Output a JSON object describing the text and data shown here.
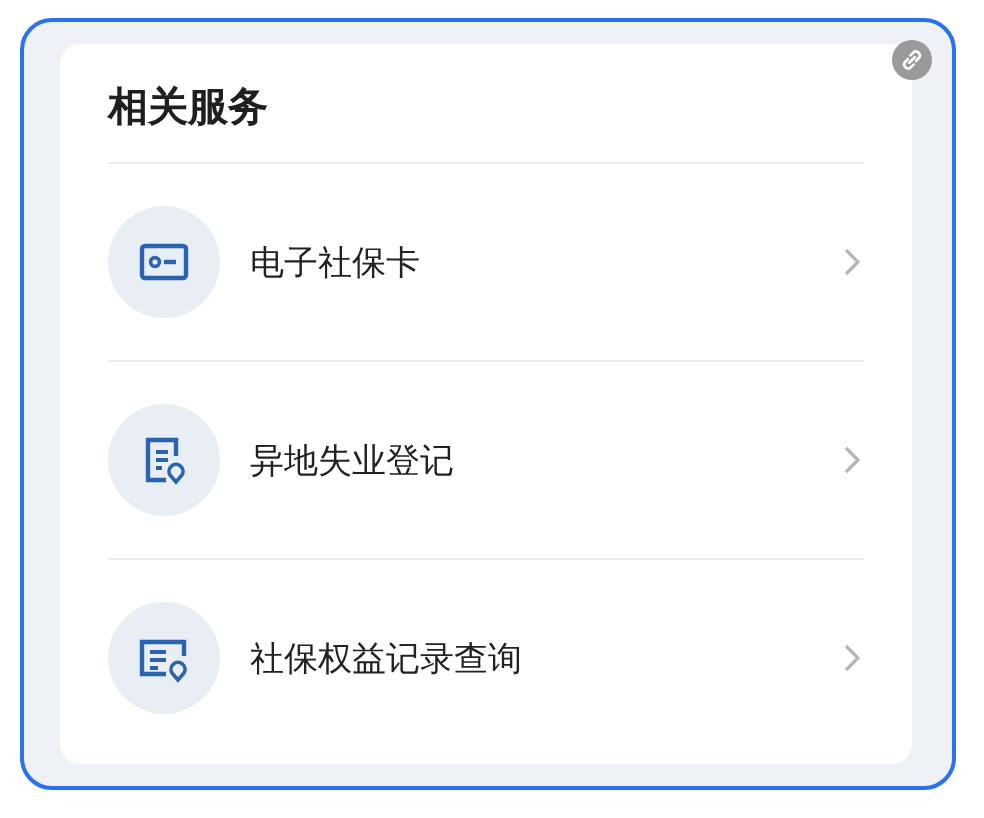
{
  "section": {
    "title": "相关服务"
  },
  "services": [
    {
      "label": "电子社保卡"
    },
    {
      "label": "异地失业登记"
    },
    {
      "label": "社保权益记录查询"
    }
  ]
}
